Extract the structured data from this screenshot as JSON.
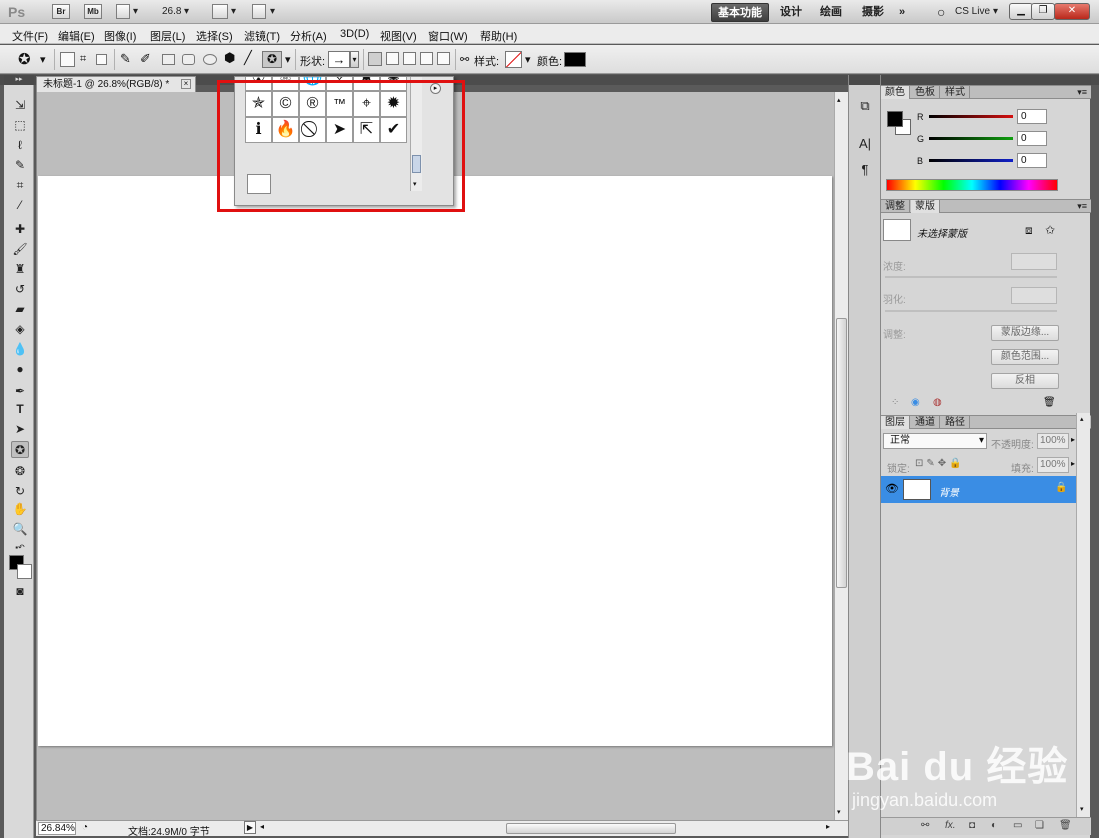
{
  "app": {
    "logo": "Ps",
    "bridge_label": "Br",
    "minibridge_label": "Mb",
    "zoom_level": "26.8",
    "workspaces": [
      "基本功能",
      "设计",
      "绘画",
      "摄影"
    ],
    "more_label": "»",
    "cslive_label": "CS Live"
  },
  "menu": {
    "items": [
      "文件(F)",
      "编辑(E)",
      "图像(I)",
      "图层(L)",
      "选择(S)",
      "滤镜(T)",
      "分析(A)",
      "3D(D)",
      "视图(V)",
      "窗口(W)",
      "帮助(H)"
    ]
  },
  "options": {
    "shape_label": "形状:",
    "style_label": "样式:",
    "color_label": "颜色:",
    "color_value": "#000000"
  },
  "document": {
    "tab_title": "未标题-1 @ 26.8%(RGB/8) *",
    "zoom_status": "26.84%",
    "doc_info": "文档:24.9M/0 字节"
  },
  "shape_picker": {
    "rows": [
      [
        "☢",
        "⚛",
        "🌐",
        "✧",
        "✸",
        "✺"
      ],
      [
        "✯",
        "©",
        "®",
        "™",
        "⌖",
        "✹"
      ],
      [
        "ℹ",
        "🔥",
        "⃠",
        "➤",
        "⇱",
        "✔"
      ]
    ]
  },
  "color_panel": {
    "tabs": [
      "颜色",
      "色板",
      "样式"
    ],
    "channels": [
      {
        "name": "R",
        "value": "0",
        "color": "#d41010"
      },
      {
        "name": "G",
        "value": "0",
        "color": "#10a010"
      },
      {
        "name": "B",
        "value": "0",
        "color": "#1020c8"
      }
    ]
  },
  "masks_panel": {
    "tabs": [
      "调整",
      "蒙版"
    ],
    "status": "未选择蒙版",
    "density_label": "浓度:",
    "feather_label": "羽化:",
    "refine_label": "调整:",
    "mask_edge_button": "蒙版边缘...",
    "color_range_button": "颜色范围...",
    "invert_button": "反相"
  },
  "layers_panel": {
    "tabs": [
      "图层",
      "通道",
      "路径"
    ],
    "blend_mode": "正常",
    "opacity_label": "不透明度:",
    "opacity_value": "100%",
    "lock_label": "锁定:",
    "fill_label": "填充:",
    "fill_value": "100%",
    "layer_name": "背景"
  },
  "watermark": {
    "brand": "Bai du 经验",
    "url": "jingyan.baidu.com"
  }
}
